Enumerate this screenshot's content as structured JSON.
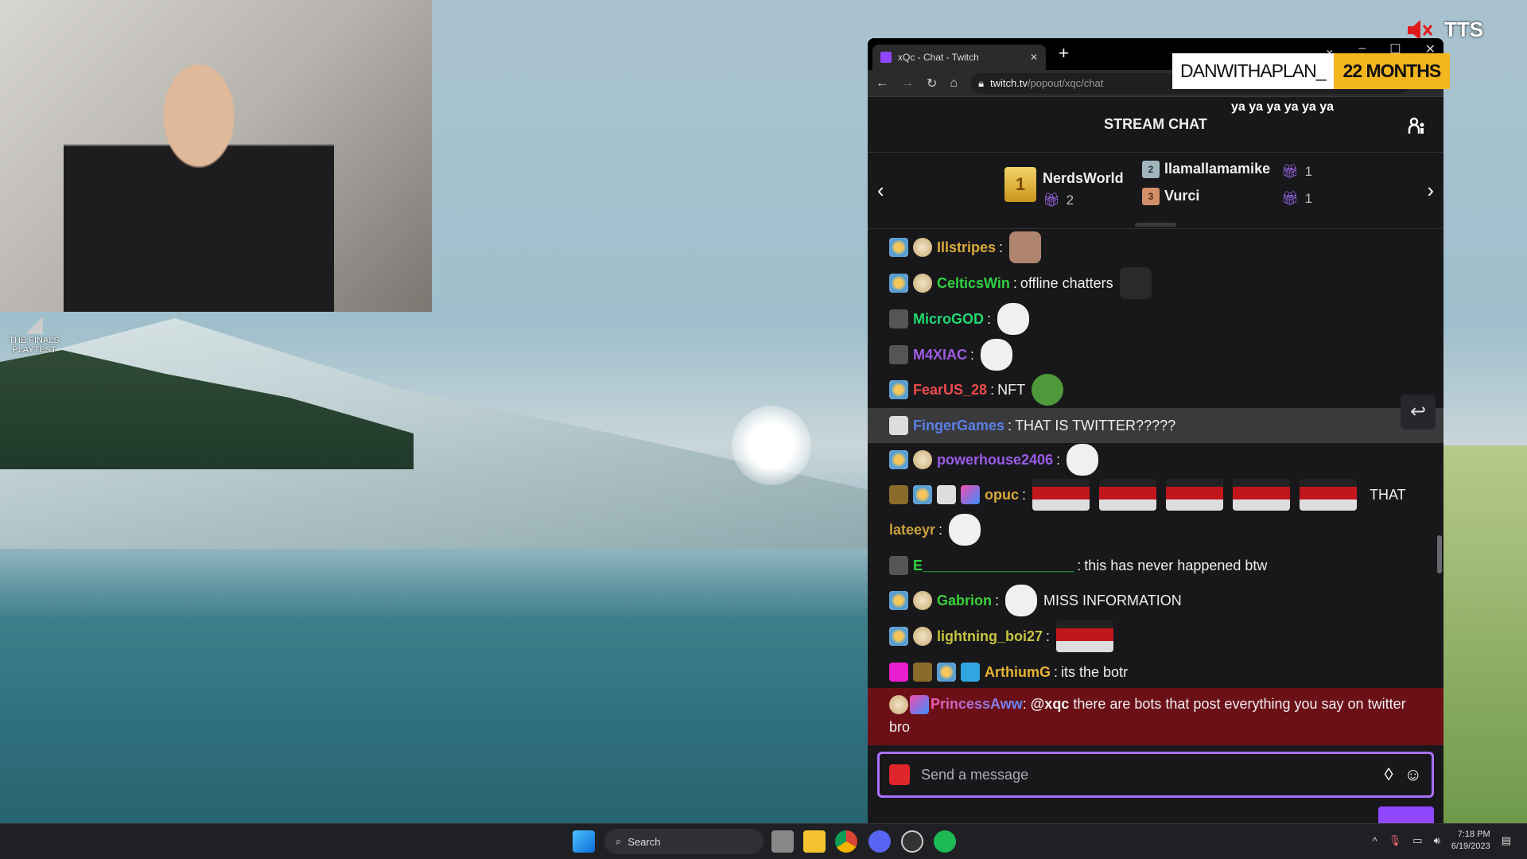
{
  "desktop": {
    "icon_label": "THE FINALS PLAYTEST"
  },
  "overlay": {
    "tts_label": "TTS",
    "tts_icon": "muted-speaker-icon",
    "sub_alert": {
      "name": "DANWITHAPLAN_",
      "months": "22 MONTHS"
    },
    "tts_text": "ya ya ya ya ya ya"
  },
  "browser": {
    "tab_title": "xQc - Chat - Twitch",
    "url_host": "twitch.tv",
    "url_path": "/popout/xqc/chat"
  },
  "chat": {
    "header": "STREAM CHAT",
    "leaderboard": [
      {
        "rank": "1",
        "name": "NerdsWorld",
        "gifts": "2"
      },
      {
        "rank": "2",
        "name": "llamallamamike",
        "gifts": "1"
      },
      {
        "rank": "3",
        "name": "Vurci",
        "gifts": "1"
      }
    ],
    "messages": [
      {
        "badges": [
          "sub",
          "coin"
        ],
        "user": "Illstripes",
        "color": "#d9a93a",
        "text": "",
        "emotes": [
          "e-photo"
        ]
      },
      {
        "badges": [
          "sub",
          "coin"
        ],
        "user": "CelticsWin",
        "color": "#2fd13f",
        "text": "offline chatters",
        "emotes": [
          "e-dark"
        ]
      },
      {
        "badges": [
          "noaudio"
        ],
        "user": "MicroGOD",
        "color": "#1fd870",
        "text": "",
        "emotes": [
          "e-face"
        ]
      },
      {
        "badges": [
          "noaudio"
        ],
        "user": "M4XIAC",
        "color": "#9d5ce0",
        "text": "",
        "emotes": [
          "e-face"
        ]
      },
      {
        "badges": [
          "sub"
        ],
        "user": "FearUS_28",
        "color": "#ee4b4b",
        "text": "NFT",
        "emotes": [
          "e-pepe"
        ]
      },
      {
        "badges": [
          "prime"
        ],
        "user": "FingerGames",
        "color": "#5a7fe6",
        "text": "THAT IS TWITTER?????",
        "emotes": [],
        "highlight": true
      },
      {
        "badges": [
          "sub",
          "coin"
        ],
        "user": "powerhouse2406",
        "color": "#9a5ce6",
        "text": "",
        "emotes": [
          "e-face"
        ]
      },
      {
        "badges": [
          "flame",
          "sub",
          "prime",
          "seven"
        ],
        "user": "opuc",
        "color": "#d9a93a",
        "text": "",
        "emotes": [
          "e-dance",
          "e-dance",
          "e-dance",
          "e-dance",
          "e-dance"
        ],
        "trail": "THAT"
      },
      {
        "badges": [],
        "user": "lateeyr",
        "color": "#c9a13f",
        "text": "",
        "emotes": [
          "e-face"
        ]
      },
      {
        "badges": [
          "noaudio"
        ],
        "user": "E___________________",
        "color": "#2fd13f",
        "text": "this has never happened btw",
        "emotes": []
      },
      {
        "badges": [
          "sub",
          "coin"
        ],
        "user": "Gabrion",
        "color": "#3ad13a",
        "text": "MISS INFORMATION",
        "emotes": [
          "e-face"
        ],
        "emote_first": true
      },
      {
        "badges": [
          "sub",
          "coin"
        ],
        "user": "lightning_boi27",
        "color": "#c8c23e",
        "text": "",
        "emotes": [
          "e-dance"
        ]
      },
      {
        "badges": [
          "gem",
          "flame",
          "sub",
          "crown"
        ],
        "user": "ArthiumG",
        "color": "#e6b331",
        "text": "its the botr",
        "emotes": []
      }
    ],
    "pinned": {
      "badges": [
        "coin",
        "seven"
      ],
      "user": "PrincessAww",
      "mention": "@xqc",
      "text": "there are bots that post everything you say on twitter bro"
    },
    "input_placeholder": "Send a message"
  },
  "taskbar": {
    "search_placeholder": "Search",
    "time": "7:18 PM",
    "date": "6/19/2023"
  },
  "colors": {
    "accent": "#9147ff",
    "input_border": "#a970ff",
    "sub_gold": "#f3b61f",
    "pinned_bg": "#6b1016"
  }
}
